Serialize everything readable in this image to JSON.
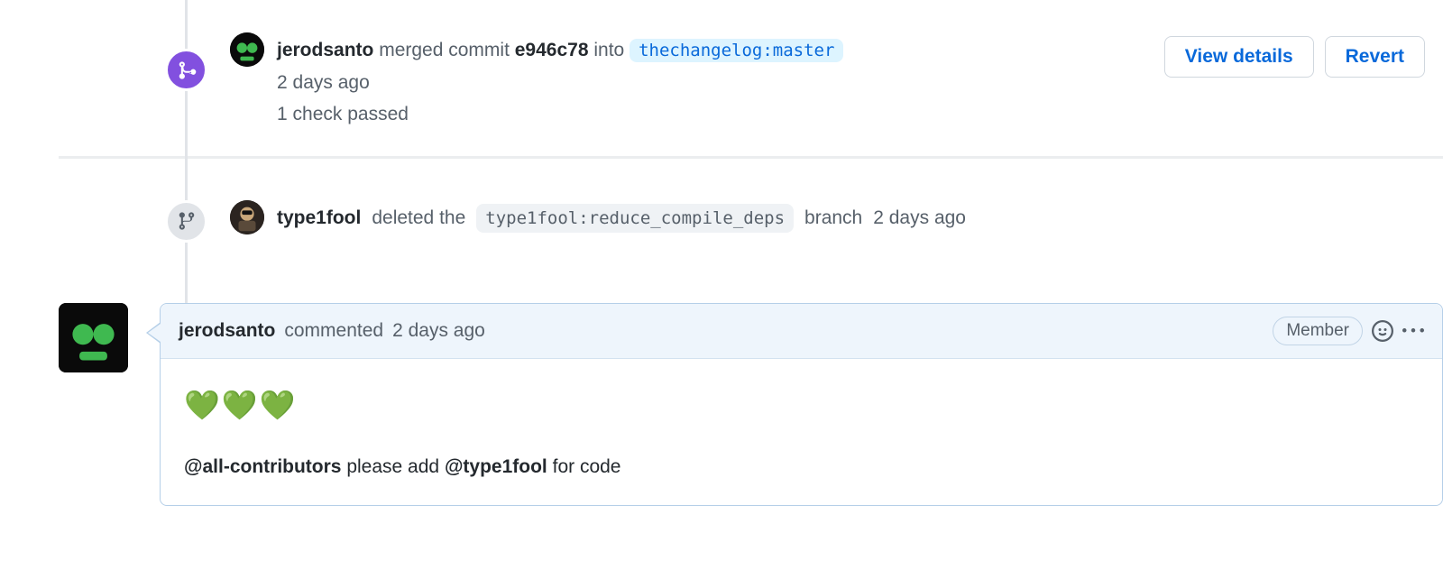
{
  "merge_event": {
    "author": "jerodsanto",
    "action_prefix": "merged commit",
    "commit_sha": "e946c78",
    "action_mid": "into",
    "target_branch": "thechangelog:master",
    "time": "2 days ago",
    "check_status": "1 check passed",
    "view_details_label": "View details",
    "revert_label": "Revert"
  },
  "delete_event": {
    "author": "type1fool",
    "action_prefix": "deleted the",
    "branch": "type1fool:reduce_compile_deps",
    "action_suffix": "branch",
    "time": "2 days ago"
  },
  "comment": {
    "author": "jerodsanto",
    "action": "commented",
    "time": "2 days ago",
    "role": "Member",
    "hearts": "💚💚💚",
    "body_mention1": "@all-contributors",
    "body_mid": "please add",
    "body_mention2": "@type1fool",
    "body_suffix": "for code"
  }
}
